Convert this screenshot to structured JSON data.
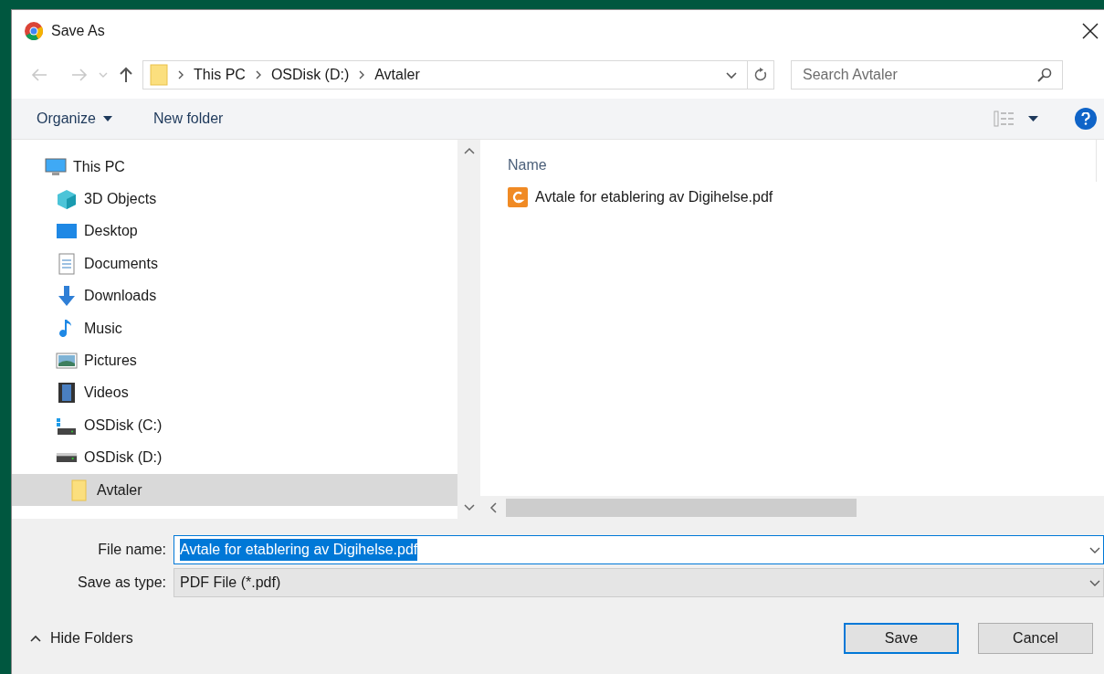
{
  "window": {
    "title": "Save As"
  },
  "address": {
    "path": [
      "This PC",
      "OSDisk (D:)",
      "Avtaler"
    ]
  },
  "search": {
    "placeholder": "Search Avtaler"
  },
  "toolbar": {
    "organize": "Organize",
    "new_folder": "New folder"
  },
  "tree": [
    {
      "label": "This PC",
      "kind": "pc",
      "selected": false,
      "children": [
        {
          "label": "3D Objects",
          "kind": "cube",
          "selected": false
        },
        {
          "label": "Desktop",
          "kind": "desktop",
          "selected": false
        },
        {
          "label": "Documents",
          "kind": "document",
          "selected": false
        },
        {
          "label": "Downloads",
          "kind": "download",
          "selected": false
        },
        {
          "label": "Music",
          "kind": "music",
          "selected": false
        },
        {
          "label": "Pictures",
          "kind": "picture",
          "selected": false
        },
        {
          "label": "Videos",
          "kind": "video",
          "selected": false
        },
        {
          "label": "OSDisk (C:)",
          "kind": "systemdrive",
          "selected": false
        },
        {
          "label": "OSDisk (D:)",
          "kind": "drive",
          "selected": false,
          "children": [
            {
              "label": "Avtaler",
              "kind": "folder",
              "selected": true
            }
          ]
        }
      ]
    }
  ],
  "file_list": {
    "columns": [
      "Name"
    ],
    "files": [
      {
        "name": "Avtale for etablering av Digihelse.pdf"
      }
    ]
  },
  "file_name": {
    "label": "File name:",
    "value": "Avtale for etablering av Digihelse.pdf"
  },
  "save_type": {
    "label": "Save as type:",
    "value": "PDF File (*.pdf)"
  },
  "hide_folders": "Hide Folders",
  "buttons": [
    {
      "label": "Save",
      "default": true
    },
    {
      "label": "Cancel",
      "default": false
    }
  ]
}
